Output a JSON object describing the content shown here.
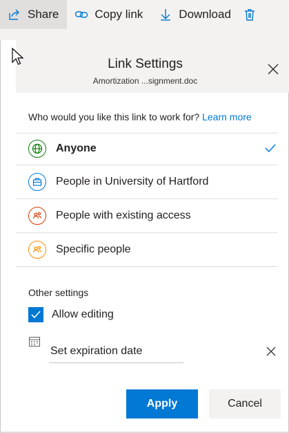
{
  "toolbar": {
    "share_label": "Share",
    "copy_link_label": "Copy link",
    "download_label": "Download"
  },
  "dialog": {
    "title": "Link Settings",
    "filename": "Amortization ...signment.doc",
    "question": "Who would you like this link to work for?",
    "learn_more": "Learn more",
    "options": [
      {
        "label": "Anyone",
        "color": "#107c10",
        "selected": true
      },
      {
        "label": "People in University of Hartford",
        "color": "#0078d4",
        "selected": false
      },
      {
        "label": "People with existing access",
        "color": "#d83b01",
        "selected": false
      },
      {
        "label": "Specific people",
        "color": "#ff8c00",
        "selected": false
      }
    ],
    "other_settings": "Other settings",
    "allow_editing": "Allow editing",
    "allow_editing_checked": true,
    "expiration_placeholder": "Set expiration date",
    "apply_label": "Apply",
    "cancel_label": "Cancel"
  },
  "colors": {
    "accent": "#0078d4",
    "band": "#f3f2f1"
  }
}
